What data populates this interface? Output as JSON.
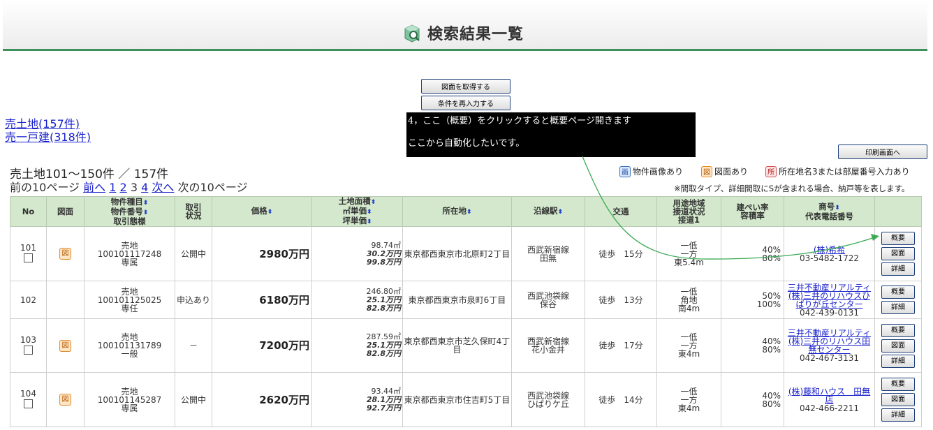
{
  "header": {
    "title": "検索結果一覧"
  },
  "buttons": {
    "get_drawings": "図面を取得する",
    "reenter": "条件を再入力する",
    "print": "印刷画面へ"
  },
  "categories": [
    {
      "label": "売土地(157件)"
    },
    {
      "label": "売一戸建(318件)"
    }
  ],
  "annotation": {
    "line1": "4，ここ（概要）をクリックすると概要ページ開きます",
    "line2": "ここから自動化したいです。"
  },
  "summary": {
    "count_text": "売土地101～150件 ／ 157件"
  },
  "pager": {
    "prev10": "前の10ページ",
    "prev": "前へ",
    "pages": [
      "1",
      "2"
    ],
    "current": "3",
    "next_page": "4",
    "next": "次へ",
    "next10": "次の10ページ"
  },
  "legend": [
    {
      "icon": "画",
      "label": "物件画像あり"
    },
    {
      "icon": "図",
      "label": "図面あり"
    },
    {
      "icon": "所",
      "label": "所在地名3または部屋番号入力あり"
    }
  ],
  "footnote": "※間取タイプ、詳細間取にSが含まれる場合、納戸等を表します。",
  "table": {
    "headers": {
      "no": "No",
      "zumen": "図面",
      "kind": [
        "物件種目",
        "物件番号",
        "取引態様"
      ],
      "status": [
        "取引",
        "状況"
      ],
      "price": "価格",
      "area": [
        "土地面積",
        "㎡単価",
        "坪単価"
      ],
      "address": "所在地",
      "station": "沿線駅",
      "access": "交通",
      "zoning": [
        "用途地域",
        "接道状況",
        "接道1"
      ],
      "ratio": [
        "建ぺい率",
        "容積率"
      ],
      "shop": [
        "商号",
        "代表電話番号"
      ]
    },
    "row_buttons": {
      "overview": "概要",
      "drawing": "図面",
      "detail": "詳細"
    },
    "rows": [
      {
        "no": "101",
        "zumen": "図",
        "kind": "売地",
        "number": "100101117248",
        "deal": "専属",
        "status": "公開中",
        "price": "2980万円",
        "area": "98.74㎡",
        "sqm": "30.2万円",
        "tsubo": "99.8万円",
        "address": "東京都西東京市北原町2丁目",
        "line": "西武新宿線",
        "station": "田無",
        "access": "徒歩　15分",
        "zone": "一低",
        "road": "一方",
        "road1": "東5.4m",
        "ratio1": "40%",
        "ratio2": "80%",
        "shop": "(株)希希",
        "phone": "03-5482-1722"
      },
      {
        "no": "102",
        "zumen": "",
        "kind": "売地",
        "number": "100101125025",
        "deal": "専任",
        "status": "申込あり",
        "price": "6180万円",
        "area": "246.80㎡",
        "sqm": "25.1万円",
        "tsubo": "82.8万円",
        "address": "東京都西東京市泉町6丁目",
        "line": "西武池袋線",
        "station": "保谷",
        "access": "徒歩　13分",
        "zone": "一低",
        "road": "角地",
        "road1": "南4m",
        "ratio1": "50%",
        "ratio2": "100%",
        "shop": "三井不動産リアルティ(株)三井のリハウスひばりが丘センター",
        "phone": "042-439-0131"
      },
      {
        "no": "103",
        "zumen": "図",
        "kind": "売地",
        "number": "100101131789",
        "deal": "一般",
        "status": "－",
        "price": "7200万円",
        "area": "287.59㎡",
        "sqm": "25.1万円",
        "tsubo": "82.8万円",
        "address": "東京都西東京市芝久保町4丁目",
        "line": "西武新宿線",
        "station": "花小金井",
        "access": "徒歩　17分",
        "zone": "一低",
        "road": "一方",
        "road1": "東4m",
        "ratio1": "40%",
        "ratio2": "80%",
        "shop": "三井不動産リアルティ(株)三井のリハウス田無センター",
        "phone": "042-467-3131"
      },
      {
        "no": "104",
        "zumen": "図",
        "kind": "売地",
        "number": "100101145287",
        "deal": "専属",
        "status": "公開中",
        "price": "2620万円",
        "area": "93.44㎡",
        "sqm": "28.1万円",
        "tsubo": "92.7万円",
        "address": "東京都西東京市住吉町5丁目",
        "line": "西武池袋線",
        "station": "ひばりケ丘",
        "access": "徒歩　14分",
        "zone": "一低",
        "road": "一方",
        "road1": "東4m",
        "ratio1": "40%",
        "ratio2": "80%",
        "shop": "(株)藤和ハウス　田無店",
        "phone": "042-466-2211"
      }
    ]
  },
  "colors": {
    "header_green": "#3f8f5a",
    "table_header": "#d3e8cc",
    "link": "#1a22cc",
    "arrow": "#3aaa55"
  }
}
